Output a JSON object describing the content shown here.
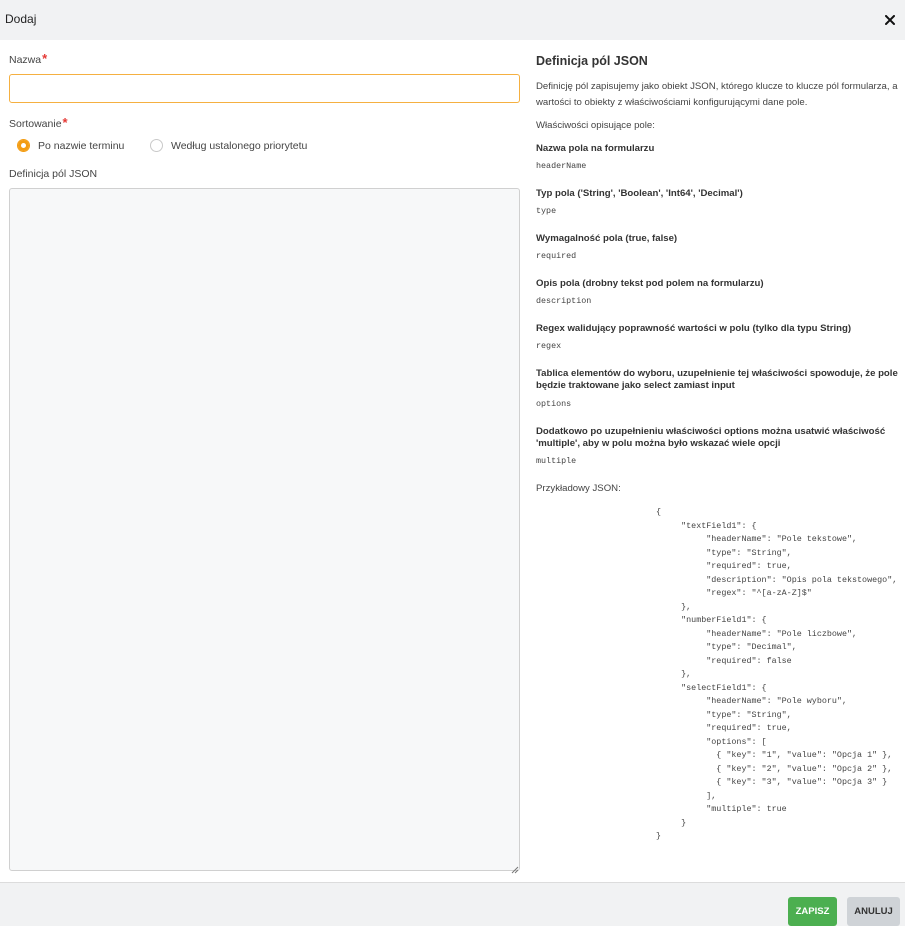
{
  "dialog": {
    "title": "Dodaj"
  },
  "form": {
    "name_label": "Nazwa",
    "name_value": "",
    "required_mark": "*",
    "sort_label": "Sortowanie",
    "sort_options": [
      {
        "label": "Po nazwie terminu",
        "checked": true
      },
      {
        "label": "Według ustalonego priorytetu",
        "checked": false
      }
    ],
    "json_label": "Definicja pól JSON",
    "json_value": ""
  },
  "help": {
    "title": "Definicja pól JSON",
    "description": "Definicję pól zapisujemy jako obiekt JSON, którego klucze to klucze pól formularza, a wartości to obiekty z właściwościami konfigurującymi dane pole.",
    "properties_heading": "Właściwości opisujące pole:",
    "properties": [
      {
        "label": "Nazwa pola na formularzu",
        "code": "headerName"
      },
      {
        "label": "Typ pola ('String', 'Boolean', 'Int64', 'Decimal')",
        "code": "type"
      },
      {
        "label": "Wymagalność pola (true, false)",
        "code": "required"
      },
      {
        "label": "Opis pola (drobny tekst pod polem na formularzu)",
        "code": "description"
      },
      {
        "label": "Regex walidujący poprawność wartości w polu (tylko dla typu String)",
        "code": "regex"
      },
      {
        "label": "Tablica elementów do wyboru, uzupełnienie tej właściwości spowoduje, że pole będzie traktowane jako select zamiast input",
        "code": "options"
      },
      {
        "label": "Dodatkowo po uzupełnieniu właściwości options można usatwić właściwość 'multiple', aby w polu można było wskazać wiele opcji",
        "code": "multiple"
      }
    ],
    "example_heading": "Przykładowy JSON:",
    "example_json": "{\n     \"textField1\": {\n          \"headerName\": \"Pole tekstowe\",\n          \"type\": \"String\",\n          \"required\": true,\n          \"description\": \"Opis pola tekstowego\",\n          \"regex\": \"^[a-zA-Z]$\"\n     },\n     \"numberField1\": {\n          \"headerName\": \"Pole liczbowe\",\n          \"type\": \"Decimal\",\n          \"required\": false\n     },\n     \"selectField1\": {\n          \"headerName\": \"Pole wyboru\",\n          \"type\": \"String\",\n          \"required\": true,\n          \"options\": [\n            { \"key\": \"1\", \"value\": \"Opcja 1\" },\n            { \"key\": \"2\", \"value\": \"Opcja 2\" },\n            { \"key\": \"3\", \"value\": \"Opcja 3\" }\n          ],\n          \"multiple\": true\n     }\n}"
  },
  "footer": {
    "save_label": "ZAPISZ",
    "cancel_label": "ANULUJ"
  },
  "colors": {
    "accent": "#f39c12",
    "required": "#e53935",
    "save": "#4caf50",
    "cancel": "#cfd3d7"
  },
  "icons": {
    "close": "close-icon",
    "resize": "resize-grip-icon"
  }
}
